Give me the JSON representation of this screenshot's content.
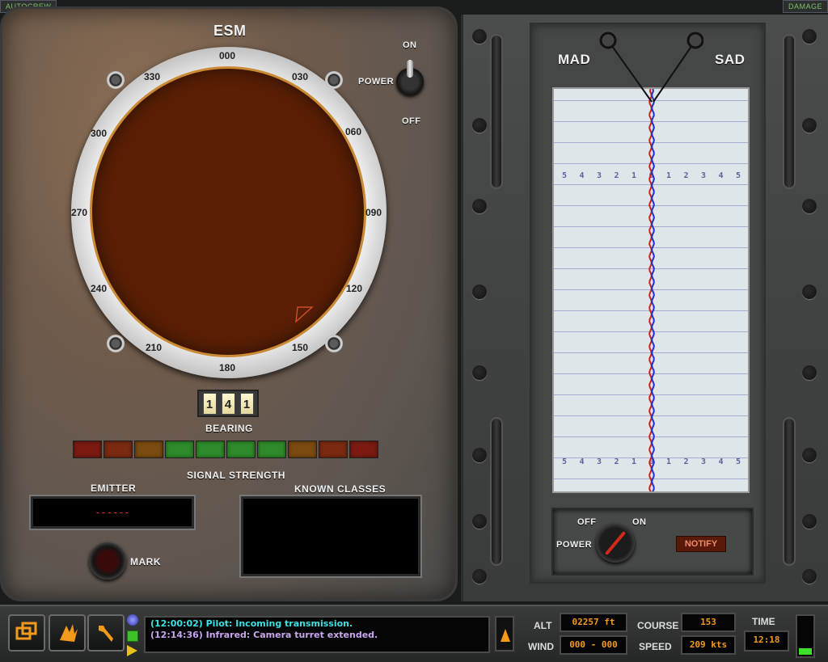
{
  "corner_tabs": {
    "left": "AUTOCREW",
    "right": "DAMAGE"
  },
  "esm": {
    "title": "ESM",
    "degrees": [
      "000",
      "030",
      "060",
      "090",
      "120",
      "150",
      "180",
      "210",
      "240",
      "270",
      "300",
      "330"
    ],
    "power": {
      "label": "POWER",
      "on": "ON",
      "off": "OFF"
    },
    "bearing_digits": [
      "1",
      "4",
      "1"
    ],
    "bearing_label": "BEARING",
    "signal_strength_label": "SIGNAL STRENGTH",
    "signal_colors": [
      "#7a1a12",
      "#7a2a10",
      "#7a4a10",
      "#2e8a2a",
      "#2e8a2a",
      "#2e8a2a",
      "#2e8a2a",
      "#7a4a10",
      "#7a2a10",
      "#7a1a12"
    ],
    "emitter_label": "EMITTER",
    "emitter_value": "------",
    "known_classes_label": "KNOWN CLASSES",
    "mark_label": "MARK",
    "face_color": "#5a1f05"
  },
  "mad": {
    "mad_label": "MAD",
    "sad_label": "SAD",
    "power": {
      "label": "POWER",
      "on": "ON",
      "off": "OFF"
    },
    "notify_label": "NOTIFY",
    "scale_row": "5 4 3 2 1 0 1 2 3 4 5"
  },
  "bottom": {
    "messages": [
      {
        "text": "(12:00:02) Pilot: Incoming transmission.",
        "color": "#3ee0e0"
      },
      {
        "text": "(12:14:36) Infrared: Camera turret extended.",
        "color": "#c9a6f0"
      }
    ],
    "alt_label": "ALT",
    "alt_value": "02257   ft",
    "wind_label": "WIND",
    "wind_value": "000 - 000",
    "course_label": "COURSE",
    "course_value": "153",
    "speed_label": "SPEED",
    "speed_value": "209  kts",
    "time_label": "TIME",
    "time_value": "12:18",
    "accent_color": "#f39a1a"
  }
}
